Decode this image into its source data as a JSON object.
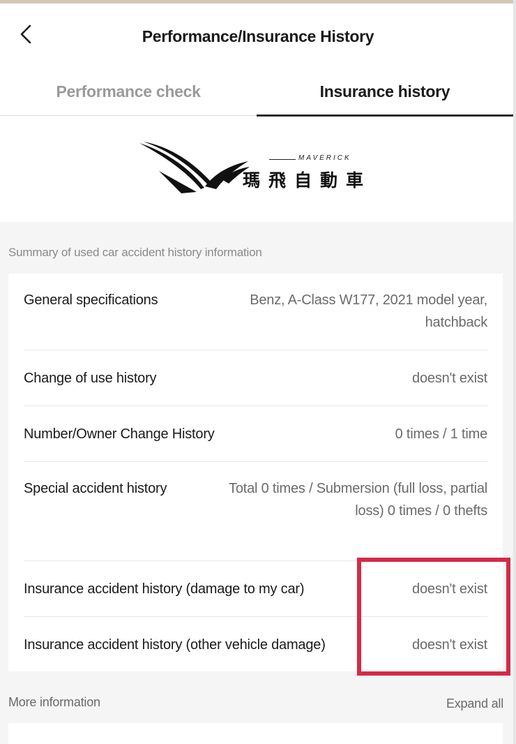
{
  "header": {
    "title": "Performance/Insurance History",
    "back_icon": "chevron-left-icon"
  },
  "tabs": [
    {
      "label": "Performance check",
      "active": false
    },
    {
      "label": "Insurance history",
      "active": true
    }
  ],
  "logo": {
    "english": "MAVERICK",
    "chinese": "瑪飛自動車"
  },
  "summary": {
    "section_label": "Summary of used car accident history information",
    "rows": [
      {
        "label": "General specifications",
        "value": "Benz, A-Class W177, 2021 model year, hatchback"
      },
      {
        "label": "Change of use history",
        "value": "doesn't exist"
      },
      {
        "label": "Number/Owner Change History",
        "value": "0 times / 1 time"
      },
      {
        "label": "Special accident history",
        "value": "Total 0 times / Submersion (full loss, partial loss) 0 times / 0 thefts"
      },
      {
        "label": "Insurance accident history (damage to my car)",
        "value": "doesn't exist"
      },
      {
        "label": "Insurance accident history (other vehicle damage)",
        "value": "doesn't exist"
      }
    ]
  },
  "more": {
    "label": "More information",
    "expand_label": "Expand all"
  },
  "colors": {
    "highlight": "#d42a47",
    "active_tab_underline": "#2b2b2b",
    "inactive_tab_text": "#9a9a9a"
  }
}
